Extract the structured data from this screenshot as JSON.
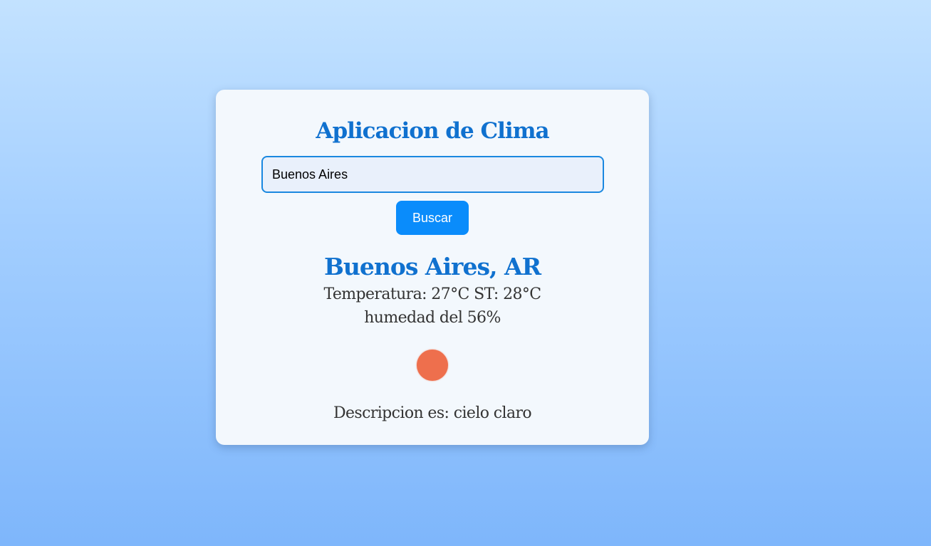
{
  "app": {
    "title": "Aplicacion de Clima"
  },
  "search": {
    "value": "Buenos Aires",
    "button_label": "Buscar"
  },
  "weather": {
    "location": "Buenos Aires, AR",
    "temperature_line": "Temperatura: 27°C ST: 28°C",
    "humidity_line": "humedad del 56%",
    "icon": "sun-icon",
    "icon_color": "#ee6f4d",
    "description_line": "Descripcion es: cielo claro"
  },
  "colors": {
    "accent": "#1071cf",
    "button": "#0a8cfb",
    "card_background": "#f3f8fd"
  }
}
